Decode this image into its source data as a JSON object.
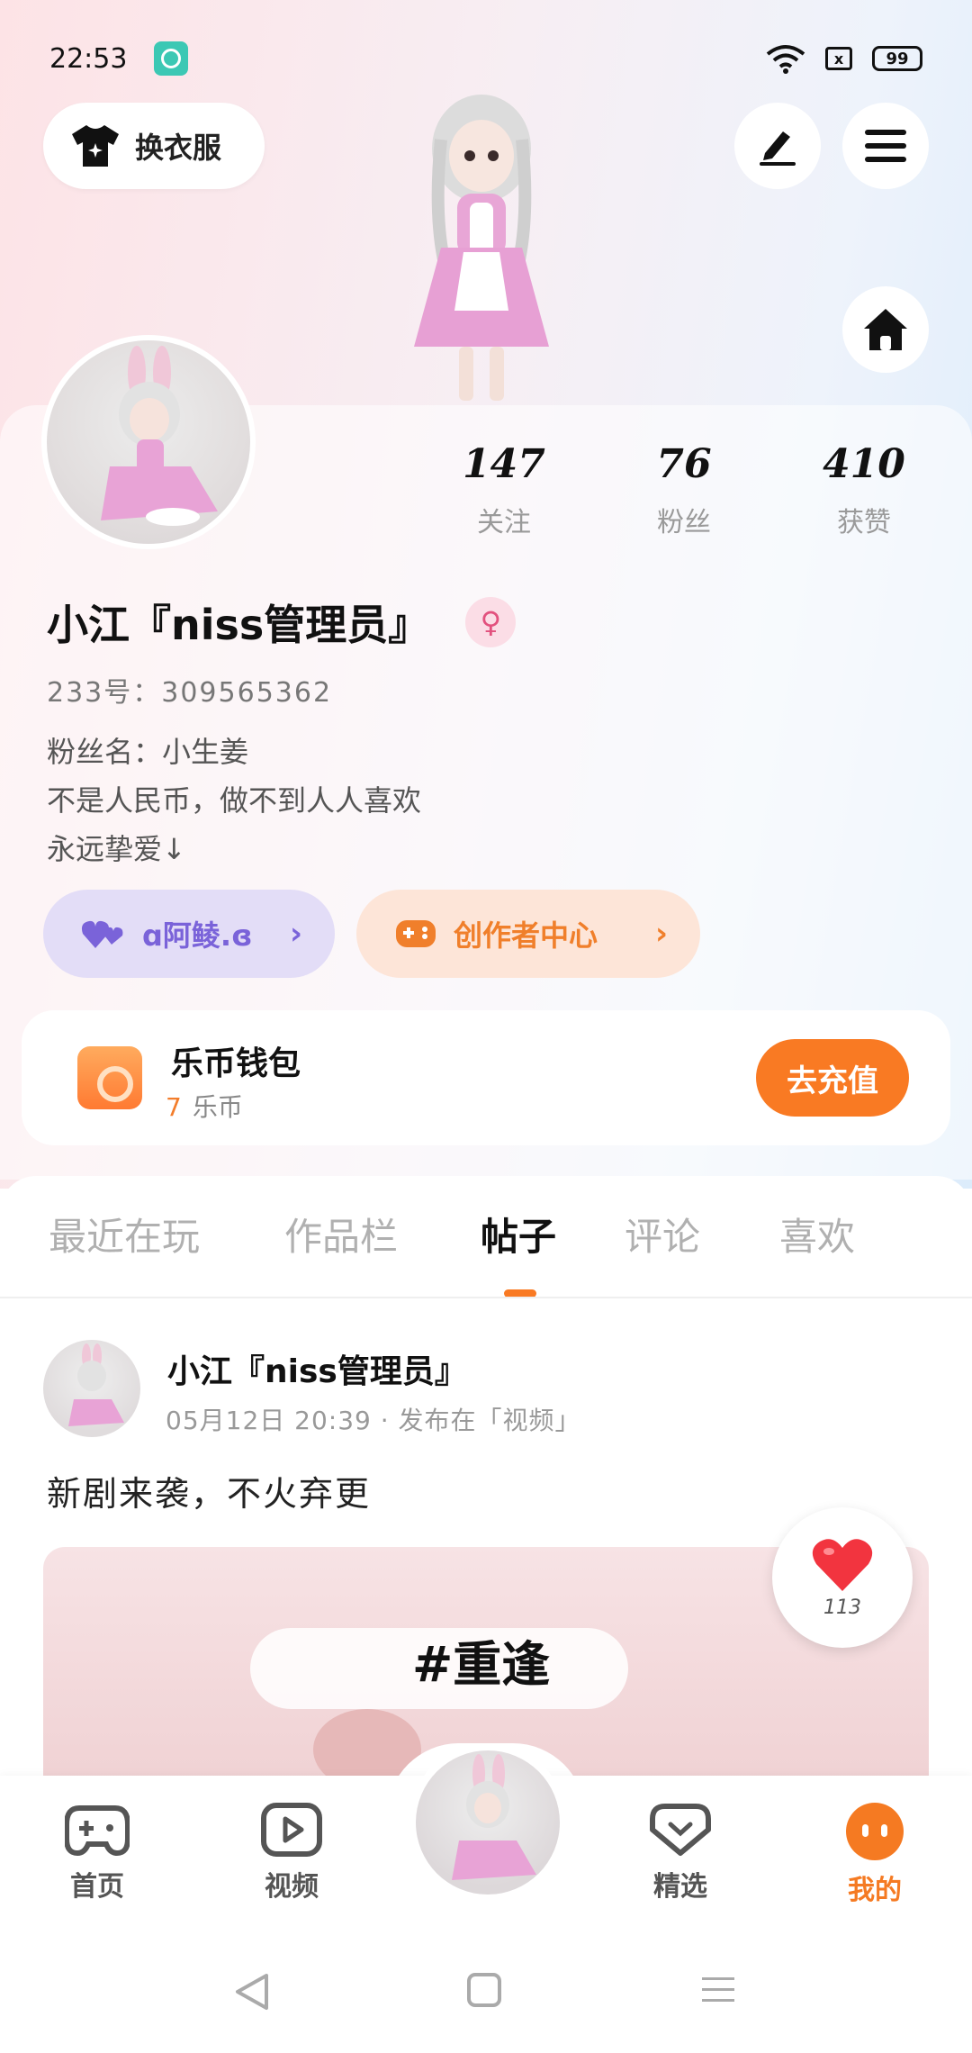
{
  "status_bar": {
    "time": "22:53",
    "battery": "99",
    "sim": "x"
  },
  "top_actions": {
    "outfit_label": "换衣服"
  },
  "stats": [
    {
      "value": "147",
      "label": "关注"
    },
    {
      "value": "76",
      "label": "粉丝"
    },
    {
      "value": "410",
      "label": "获赞"
    }
  ],
  "profile": {
    "name": "小江『niss管理员』",
    "gender_symbol": "♀",
    "uid": "233号：309565362",
    "bio_lines": [
      "粉丝名：小生姜",
      "不是人民币，做不到人人喜欢",
      "永远挚爱↓"
    ]
  },
  "pills": {
    "guild": "ɑ阿鲮.ɞ",
    "creator": "创作者中心",
    "chevron": "›"
  },
  "wallet": {
    "title": "乐币钱包",
    "balance_value": "7",
    "balance_unit": "乐币",
    "recharge_label": "去充值"
  },
  "tabs": [
    "最近在玩",
    "作品栏",
    "帖子",
    "评论",
    "喜欢"
  ],
  "active_tab": "帖子",
  "post": {
    "author": "小江『niss管理员』",
    "meta": "05月12日 20:39 · 发布在「视频」",
    "text": "新剧来袭，不火弃更",
    "media_caption": "#重逢",
    "likes": "113"
  },
  "bottom_nav": [
    {
      "label": "首页",
      "icon": "gamepad-icon"
    },
    {
      "label": "视频",
      "icon": "video-play-icon"
    },
    {
      "label": "精选",
      "icon": "heart-chat-icon"
    },
    {
      "label": "我的",
      "icon": "face-icon",
      "active": true
    }
  ],
  "colors": {
    "accent": "#f97a23",
    "guild": "#7a63d9",
    "gender": "#e2517e"
  }
}
